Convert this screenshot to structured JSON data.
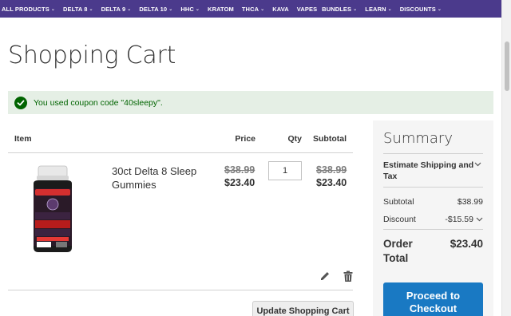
{
  "nav": {
    "items": [
      {
        "label": "ALL PRODUCTS",
        "chevron": true
      },
      {
        "label": "DELTA 8",
        "chevron": true
      },
      {
        "label": "DELTA 9",
        "chevron": true
      },
      {
        "label": "DELTA 10",
        "chevron": true
      },
      {
        "label": "HHC",
        "chevron": true
      },
      {
        "label": "KRATOM",
        "chevron": false
      },
      {
        "label": "THCA",
        "chevron": true
      },
      {
        "label": "KAVA",
        "chevron": false
      },
      {
        "label": "VAPES",
        "chevron": false
      },
      {
        "label": "BUNDLES",
        "chevron": true
      },
      {
        "label": "LEARN",
        "chevron": true
      },
      {
        "label": "DISCOUNTS",
        "chevron": true
      }
    ],
    "chevron_glyph": "⌄"
  },
  "page": {
    "title": "Shopping Cart"
  },
  "message": {
    "text": "You used coupon code \"40sleepy\"."
  },
  "cart": {
    "headers": {
      "item": "Item",
      "price": "Price",
      "qty": "Qty",
      "subtotal": "Subtotal"
    },
    "item": {
      "name": "30ct Delta 8 Sleep Gummies",
      "price_original": "$38.99",
      "price_final": "$23.40",
      "qty": "1",
      "subtotal_original": "$38.99",
      "subtotal_final": "$23.40",
      "image_text": {
        "badge": "5mg of CBN",
        "brand": "MYSTIC LABS",
        "line1": "DELTA-8THC",
        "line2": "SLEEP",
        "line3": "GUMMIES",
        "dose": "750MG",
        "count": "30 CT"
      }
    },
    "update_label": "Update Shopping Cart"
  },
  "summary": {
    "title": "Summary",
    "shipping_label": "Estimate Shipping and Tax",
    "subtotal_label": "Subtotal",
    "subtotal_value": "$38.99",
    "discount_label": "Discount",
    "discount_value": "-$15.59",
    "order_total_label": "Order Total",
    "order_total_value": "$23.40",
    "checkout_label": "Proceed to Checkout"
  },
  "colors": {
    "nav_bg": "#4b3a8c",
    "success_bg": "#e5efe5",
    "success_text": "#006400",
    "checkout_bg": "#1979c3",
    "summary_bg": "#f5f5f5"
  }
}
